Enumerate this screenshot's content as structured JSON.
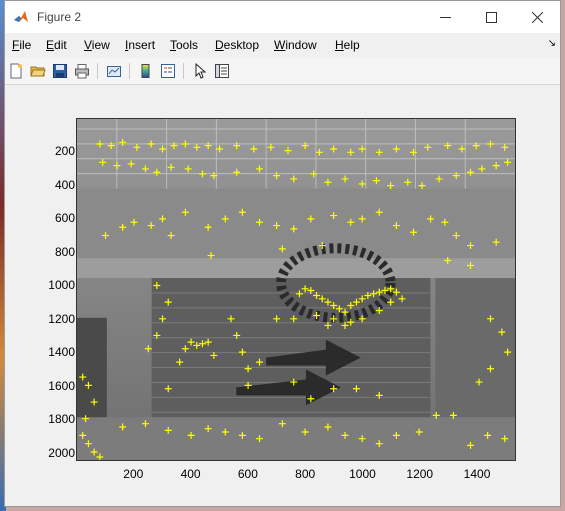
{
  "window": {
    "title": "Figure 2"
  },
  "menu": {
    "items": [
      {
        "label": "File",
        "u": "F",
        "rest": "ile"
      },
      {
        "label": "Edit",
        "u": "E",
        "rest": "dit"
      },
      {
        "label": "View",
        "u": "V",
        "rest": "iew"
      },
      {
        "label": "Insert",
        "u": "I",
        "rest": "nsert"
      },
      {
        "label": "Tools",
        "u": "T",
        "rest": "ools"
      },
      {
        "label": "Desktop",
        "u": "D",
        "rest": "esktop"
      },
      {
        "label": "Window",
        "u": "W",
        "rest": "indow"
      },
      {
        "label": "Help",
        "u": "H",
        "rest": "elp"
      }
    ],
    "dock_glyph": "↘"
  },
  "toolbar": {
    "icons": [
      "new-figure-icon",
      "open-file-icon",
      "save-icon",
      "print-icon",
      "link-plot-icon",
      "insert-colorbar-icon",
      "insert-legend-icon",
      "select-arrow-icon",
      "property-inspector-icon"
    ]
  },
  "chart_data": {
    "type": "scatter",
    "title": "",
    "xlabel": "",
    "ylabel": "",
    "x_ticks": [
      "200",
      "400",
      "600",
      "800",
      "1000",
      "1200",
      "1400"
    ],
    "y_ticks": [
      "200",
      "400",
      "600",
      "800",
      "1000",
      "1200",
      "1400",
      "1600",
      "1800",
      "2000"
    ],
    "xlim": [
      0,
      1536
    ],
    "ylim": [
      2048,
      0
    ],
    "marker": "+",
    "marker_color": "#ffff00",
    "background": "grayscale photo of a building facade with roll-up doors",
    "series": [
      {
        "values": [
          [
            80,
            150
          ],
          [
            120,
            160
          ],
          [
            160,
            140
          ],
          [
            210,
            170
          ],
          [
            260,
            150
          ],
          [
            300,
            180
          ],
          [
            340,
            160
          ],
          [
            380,
            150
          ],
          [
            420,
            170
          ],
          [
            460,
            160
          ],
          [
            500,
            180
          ],
          [
            560,
            160
          ],
          [
            620,
            180
          ],
          [
            680,
            170
          ],
          [
            740,
            190
          ],
          [
            800,
            160
          ],
          [
            850,
            200
          ],
          [
            900,
            180
          ],
          [
            960,
            200
          ],
          [
            1000,
            180
          ],
          [
            1060,
            200
          ],
          [
            1120,
            180
          ],
          [
            1180,
            200
          ],
          [
            1230,
            170
          ],
          [
            1300,
            160
          ],
          [
            1350,
            180
          ],
          [
            1400,
            160
          ],
          [
            1450,
            150
          ],
          [
            1500,
            170
          ],
          [
            90,
            260
          ],
          [
            140,
            280
          ],
          [
            190,
            270
          ],
          [
            240,
            300
          ],
          [
            280,
            320
          ],
          [
            330,
            290
          ],
          [
            390,
            300
          ],
          [
            440,
            330
          ],
          [
            480,
            340
          ],
          [
            560,
            320
          ],
          [
            640,
            300
          ],
          [
            700,
            340
          ],
          [
            760,
            360
          ],
          [
            830,
            330
          ],
          [
            880,
            380
          ],
          [
            940,
            360
          ],
          [
            1000,
            390
          ],
          [
            1050,
            370
          ],
          [
            1100,
            400
          ],
          [
            1160,
            380
          ],
          [
            1210,
            400
          ],
          [
            1270,
            360
          ],
          [
            1330,
            340
          ],
          [
            1380,
            320
          ],
          [
            1420,
            300
          ],
          [
            1470,
            280
          ],
          [
            1510,
            260
          ],
          [
            100,
            700
          ],
          [
            160,
            650
          ],
          [
            200,
            620
          ],
          [
            260,
            640
          ],
          [
            300,
            600
          ],
          [
            330,
            700
          ],
          [
            380,
            560
          ],
          [
            460,
            650
          ],
          [
            520,
            600
          ],
          [
            580,
            560
          ],
          [
            640,
            620
          ],
          [
            700,
            640
          ],
          [
            760,
            660
          ],
          [
            820,
            600
          ],
          [
            900,
            580
          ],
          [
            960,
            620
          ],
          [
            1000,
            600
          ],
          [
            1060,
            560
          ],
          [
            1120,
            640
          ],
          [
            1180,
            680
          ],
          [
            1240,
            600
          ],
          [
            1290,
            620
          ],
          [
            1330,
            700
          ],
          [
            1380,
            760
          ],
          [
            1470,
            740
          ],
          [
            470,
            820
          ],
          [
            720,
            780
          ],
          [
            860,
            760
          ],
          [
            1300,
            850
          ],
          [
            1380,
            880
          ],
          [
            280,
            1000
          ],
          [
            320,
            1100
          ],
          [
            300,
            1200
          ],
          [
            280,
            1300
          ],
          [
            250,
            1380
          ],
          [
            380,
            1380
          ],
          [
            400,
            1340
          ],
          [
            420,
            1360
          ],
          [
            440,
            1350
          ],
          [
            460,
            1340
          ],
          [
            540,
            1200
          ],
          [
            560,
            1300
          ],
          [
            580,
            1400
          ],
          [
            600,
            1500
          ],
          [
            640,
            1460
          ],
          [
            700,
            1200
          ],
          [
            760,
            1200
          ],
          [
            780,
            1050
          ],
          [
            800,
            1020
          ],
          [
            820,
            1030
          ],
          [
            840,
            1060
          ],
          [
            860,
            1080
          ],
          [
            880,
            1100
          ],
          [
            900,
            1120
          ],
          [
            920,
            1140
          ],
          [
            940,
            1160
          ],
          [
            960,
            1120
          ],
          [
            980,
            1100
          ],
          [
            1000,
            1080
          ],
          [
            1020,
            1060
          ],
          [
            1040,
            1050
          ],
          [
            1060,
            1040
          ],
          [
            1080,
            1030
          ],
          [
            1100,
            1020
          ],
          [
            1120,
            1040
          ],
          [
            1000,
            1200
          ],
          [
            960,
            1220
          ],
          [
            900,
            1200
          ],
          [
            840,
            1180
          ],
          [
            880,
            1240
          ],
          [
            940,
            1240
          ],
          [
            1060,
            1150
          ],
          [
            1100,
            1100
          ],
          [
            1140,
            1080
          ],
          [
            20,
            1550
          ],
          [
            40,
            1600
          ],
          [
            60,
            1700
          ],
          [
            30,
            1800
          ],
          [
            20,
            1900
          ],
          [
            40,
            1950
          ],
          [
            60,
            2000
          ],
          [
            80,
            2030
          ],
          [
            160,
            1850
          ],
          [
            240,
            1830
          ],
          [
            320,
            1870
          ],
          [
            400,
            1900
          ],
          [
            460,
            1860
          ],
          [
            520,
            1880
          ],
          [
            580,
            1900
          ],
          [
            640,
            1920
          ],
          [
            720,
            1830
          ],
          [
            800,
            1880
          ],
          [
            880,
            1850
          ],
          [
            940,
            1900
          ],
          [
            1000,
            1920
          ],
          [
            1060,
            1950
          ],
          [
            1120,
            1900
          ],
          [
            1200,
            1880
          ],
          [
            1260,
            1780
          ],
          [
            1320,
            1780
          ],
          [
            1380,
            1960
          ],
          [
            1440,
            1900
          ],
          [
            1500,
            1920
          ],
          [
            1450,
            1200
          ],
          [
            1490,
            1280
          ],
          [
            1510,
            1400
          ],
          [
            1450,
            1500
          ],
          [
            1410,
            1580
          ],
          [
            320,
            1620
          ],
          [
            360,
            1460
          ],
          [
            480,
            1420
          ],
          [
            600,
            1600
          ],
          [
            760,
            1580
          ],
          [
            820,
            1680
          ],
          [
            900,
            1620
          ],
          [
            980,
            1620
          ],
          [
            1060,
            1660
          ]
        ]
      }
    ]
  }
}
